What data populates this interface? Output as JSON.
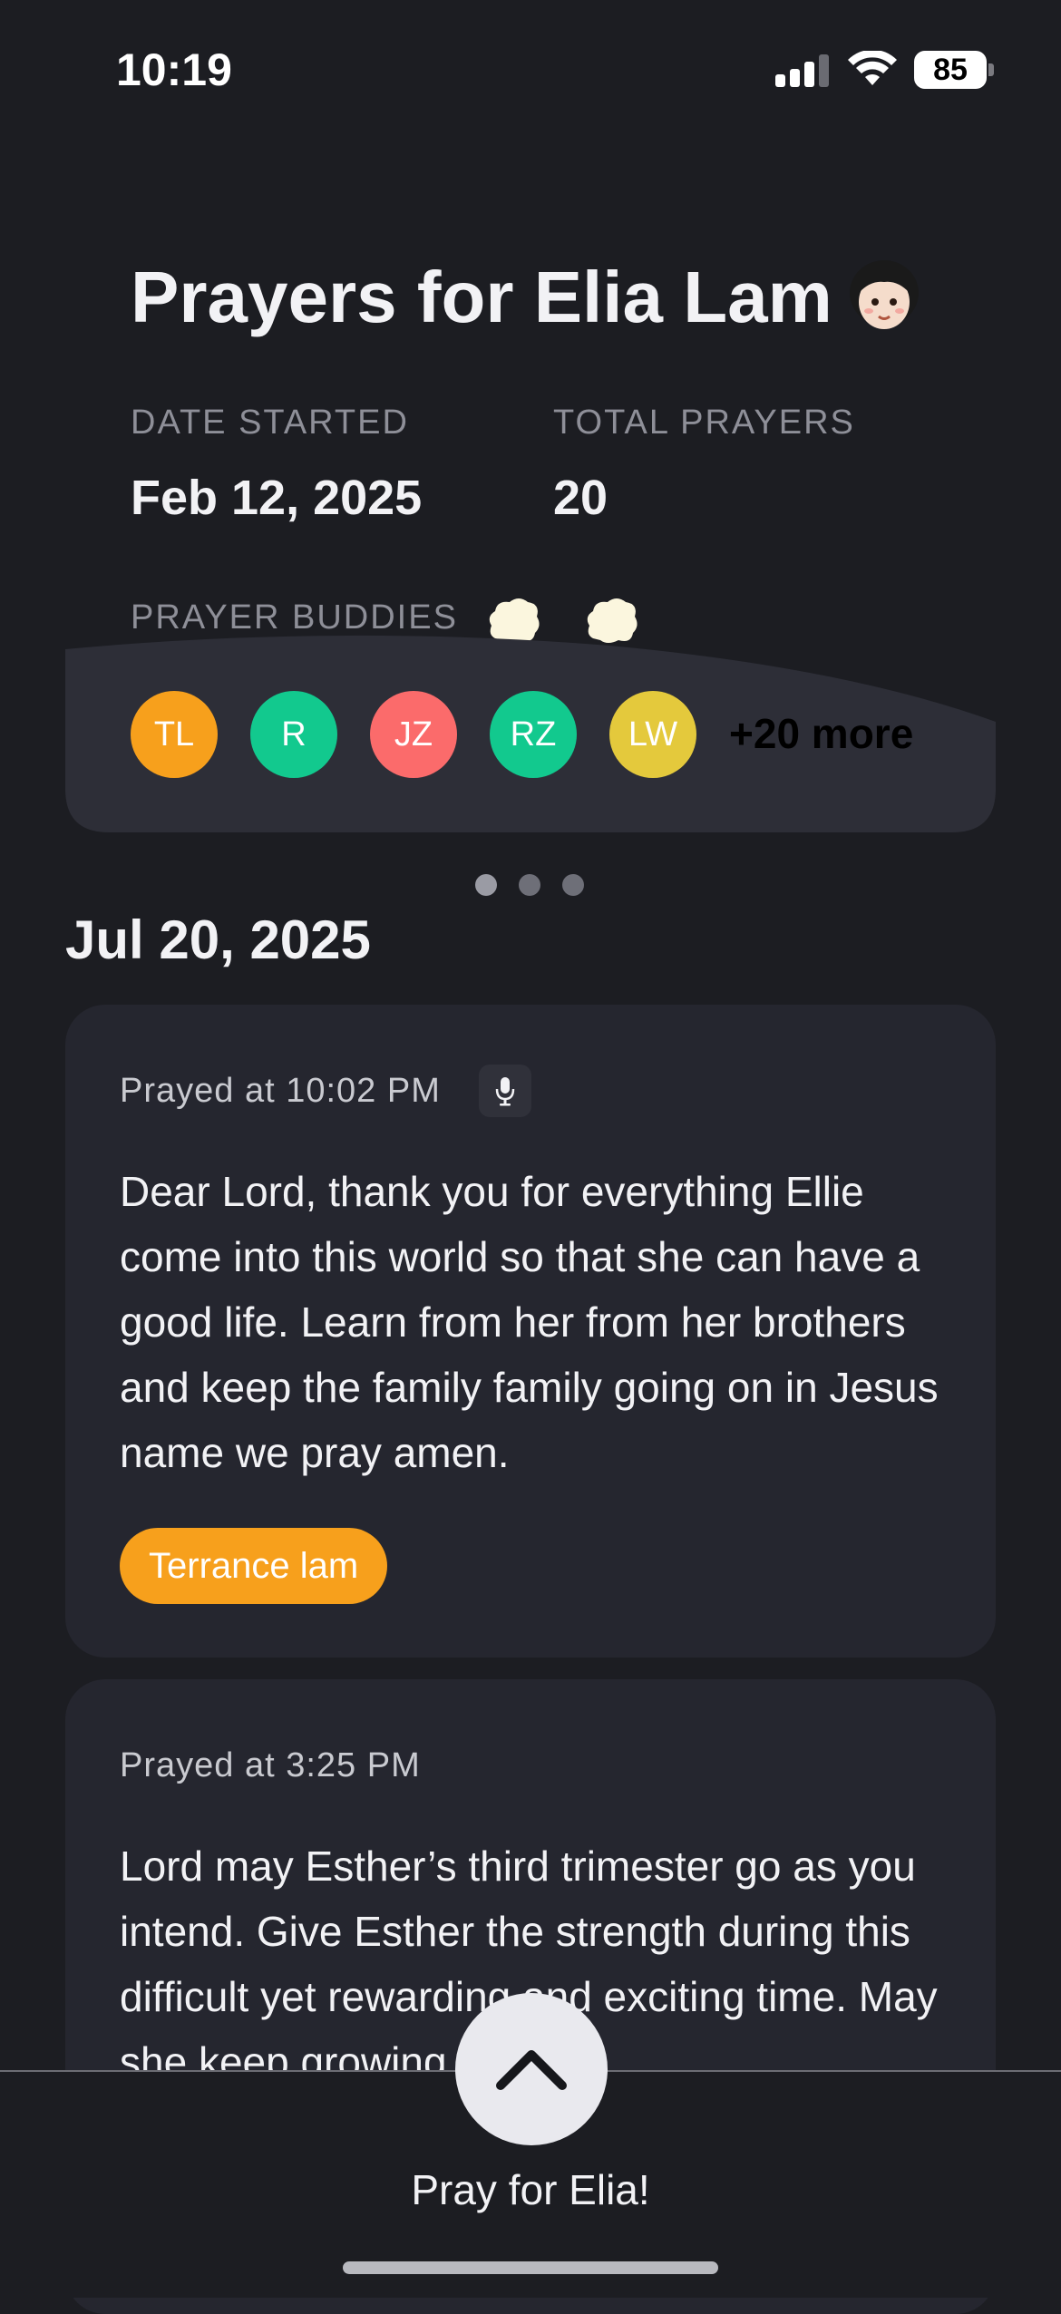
{
  "status_bar": {
    "time": "10:19",
    "battery": "85"
  },
  "header": {
    "title": "Prayers for Elia Lam",
    "date_started_label": "DATE STARTED",
    "date_started_value": "Feb 12, 2025",
    "total_prayers_label": "TOTAL PRAYERS",
    "total_prayers_value": "20",
    "buddies_label": "PRAYER BUDDIES"
  },
  "buddies": {
    "items": [
      {
        "initials": "TL",
        "color": "#f7a01c"
      },
      {
        "initials": "R",
        "color": "#12c98e"
      },
      {
        "initials": "JZ",
        "color": "#fb6b6b"
      },
      {
        "initials": "RZ",
        "color": "#12c98e"
      },
      {
        "initials": "LW",
        "color": "#e4c93c"
      }
    ],
    "more": "+20 more"
  },
  "carousel": {
    "pages": 3,
    "active": 0
  },
  "feed": {
    "date": "Jul 20, 2025",
    "prayers": [
      {
        "prayed_at": "Prayed at 10:02 PM",
        "text": "Dear Lord, thank you for everything Ellie come into this world so that she can have a good life. Learn from her from her brothers and keep the family family going on in Jesus name we pray amen.",
        "author": "Terrance lam",
        "author_color": "#f7a01c"
      },
      {
        "prayed_at": "Prayed at 3:25 PM",
        "text": "Lord may Esther’s third trimester go as you intend. Give Esther the strength during this difficult yet rewarding and exciting time. May she keep growing so"
      }
    ]
  },
  "action": {
    "label": "Pray for Elia!",
    "icon": "chevron-up-icon"
  },
  "colors": {
    "background": "#1c1d22",
    "card": "#25262f",
    "accent": "#f7a01c"
  }
}
